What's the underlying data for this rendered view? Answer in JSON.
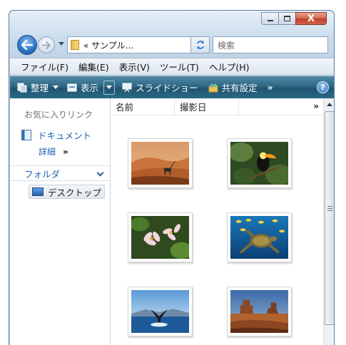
{
  "window": {
    "close_glyph": "X"
  },
  "nav": {
    "address_text": "«  サンプル...",
    "search_placeholder": "検索"
  },
  "menu": {
    "items": [
      "ファイル(F)",
      "編集(E)",
      "表示(V)",
      "ツール(T)",
      "ヘルプ(H)"
    ]
  },
  "toolbar": {
    "organize": "整理",
    "views": "表示",
    "slideshow": "スライドショー",
    "share": "共有設定",
    "more": "»",
    "help": "?"
  },
  "nav_pane": {
    "favorites_heading": "お気に入りリンク",
    "documents_link": "ドキュメント",
    "more_link": "詳細",
    "more_glyph": "»",
    "folders_label": "フォルダ",
    "desktop_item": "デスクトップ"
  },
  "file_pane": {
    "columns": [
      "名前",
      "撮影日"
    ],
    "more_columns": "»",
    "thumbnails": [
      "desert-oryx-photo",
      "toucan-photo",
      "frangipani-flowers-photo",
      "sea-turtle-photo",
      "whale-tail-photo",
      "monument-valley-photo"
    ]
  }
}
